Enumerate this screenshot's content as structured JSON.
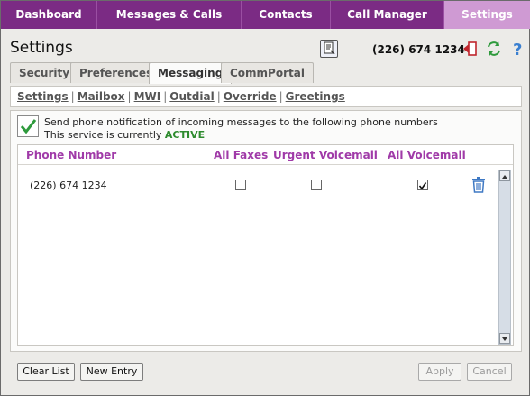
{
  "topnav": {
    "items": [
      "Dashboard",
      "Messages & Calls",
      "Contacts",
      "Call Manager",
      "Settings"
    ],
    "active": "Settings"
  },
  "header": {
    "title": "Settings",
    "phone": "(226) 674 1234"
  },
  "tabs": [
    "Security",
    "Preferences",
    "Messaging",
    "CommPortal Assistant"
  ],
  "active_tab": "Messaging",
  "subnav": [
    "Settings",
    "Mailbox",
    "MWI",
    "Outdial",
    "Override",
    "Greetings"
  ],
  "notification": {
    "checked": true,
    "line1": "Send phone notification of incoming messages to the following phone numbers",
    "line2_prefix": "This service is currently",
    "status": "ACTIVE"
  },
  "table": {
    "headers": [
      "Phone Number",
      "All Faxes",
      "Urgent Voicemail",
      "All Voicemail"
    ],
    "rows": [
      {
        "phone": "(226) 674 1234",
        "all_faxes": false,
        "urgent_voicemail": false,
        "all_voicemail": true
      }
    ]
  },
  "buttons": {
    "clear_list": "Clear List",
    "new_entry": "New Entry",
    "apply": "Apply",
    "cancel": "Cancel"
  },
  "colors": {
    "nav_bg": "#7b2b84",
    "nav_active": "#cf9ad3",
    "header_text": "#a03aa8",
    "status_active": "#2e8b2e"
  }
}
